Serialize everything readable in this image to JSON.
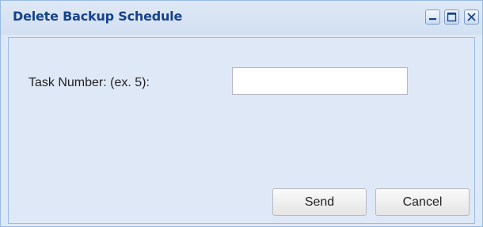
{
  "window": {
    "title": "Delete Backup Schedule",
    "tools": {
      "minimize_icon": "minimize-icon",
      "maximize_icon": "maximize-icon",
      "close_icon": "close-icon"
    }
  },
  "form": {
    "task_number_label": "Task Number: (ex. 5):",
    "task_number_value": "",
    "task_number_placeholder": ""
  },
  "buttons": {
    "send_label": "Send",
    "cancel_label": "Cancel"
  },
  "colors": {
    "title_text": "#15428b",
    "window_background": "#dfe8f6",
    "border": "#99bbe8"
  }
}
